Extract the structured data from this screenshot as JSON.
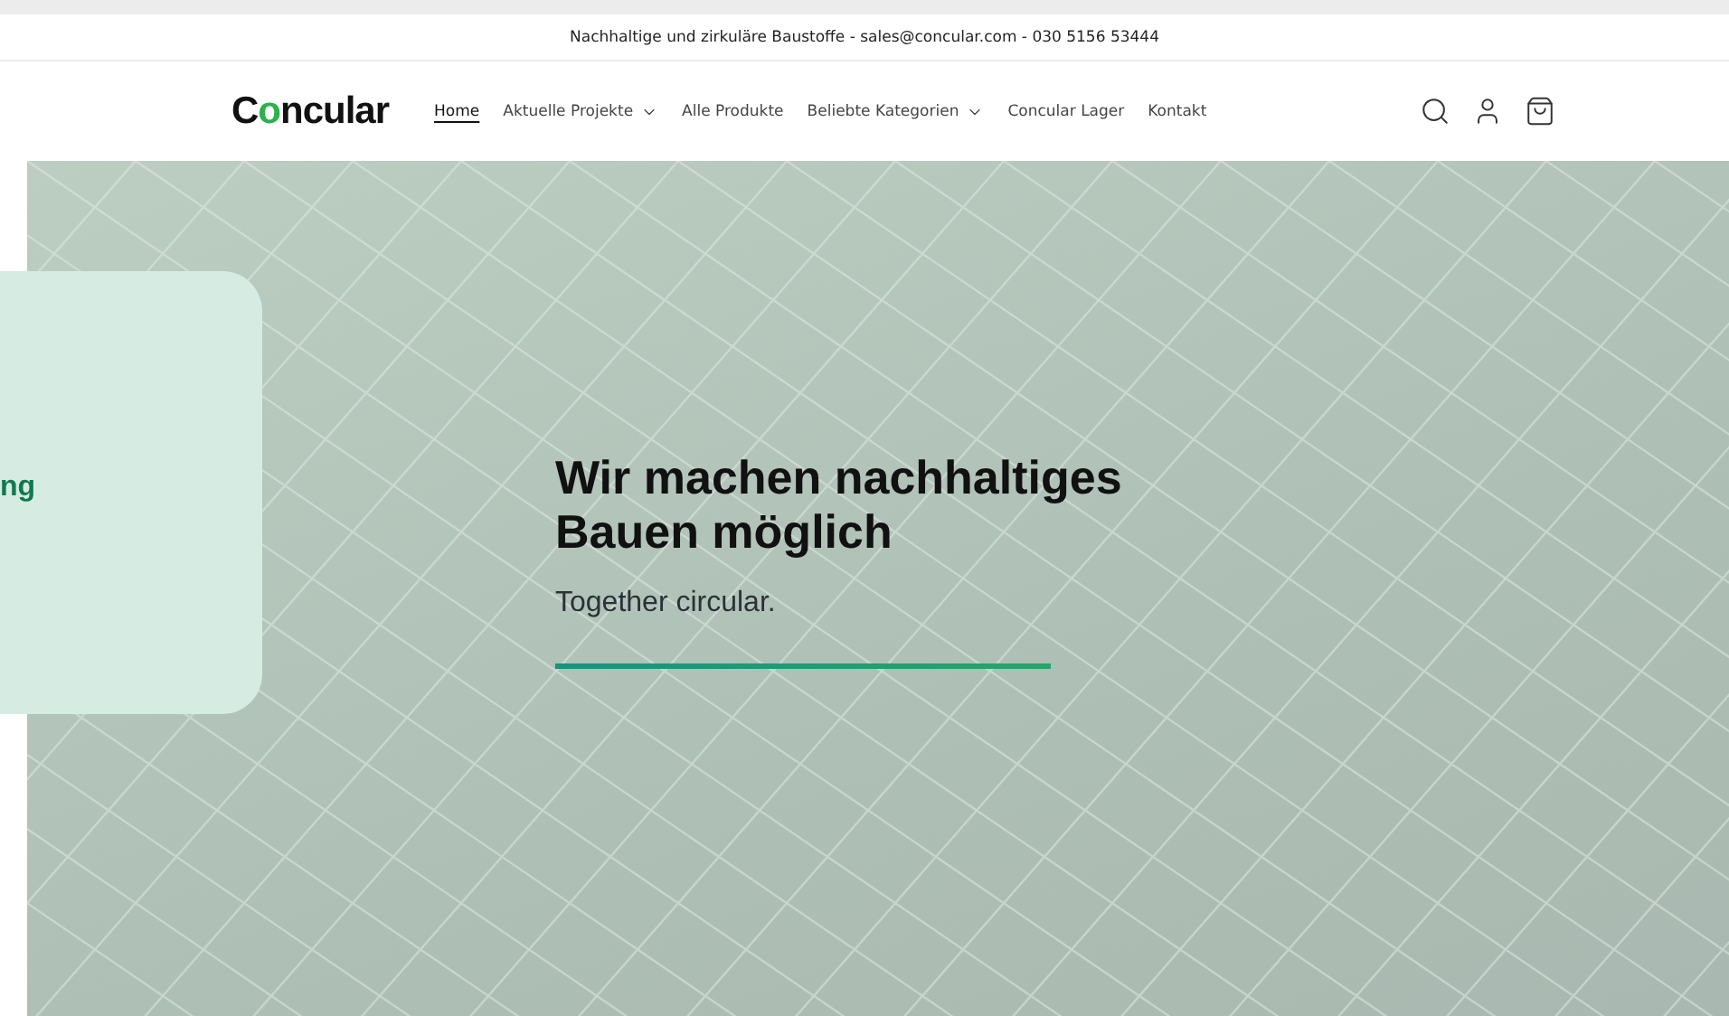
{
  "announcement": "Nachhaltige und zirkuläre Baustoffe - sales@concular.com - 030 5156 53444",
  "logo": "Concular",
  "nav": [
    {
      "label": "Home",
      "selected": true,
      "dropdown": false
    },
    {
      "label": "Aktuelle Projekte",
      "selected": false,
      "dropdown": true
    },
    {
      "label": "Alle Produkte",
      "selected": false,
      "dropdown": false
    },
    {
      "label": "Beliebte Kategorien",
      "selected": false,
      "dropdown": true
    },
    {
      "label": "Concular Lager",
      "selected": false,
      "dropdown": false
    },
    {
      "label": "Kontakt",
      "selected": false,
      "dropdown": false
    }
  ],
  "hero": {
    "title": "Wir machen nachhaltiges Bauen möglich",
    "subtitle": "Together circular."
  },
  "side_card": {
    "text": "ng"
  }
}
